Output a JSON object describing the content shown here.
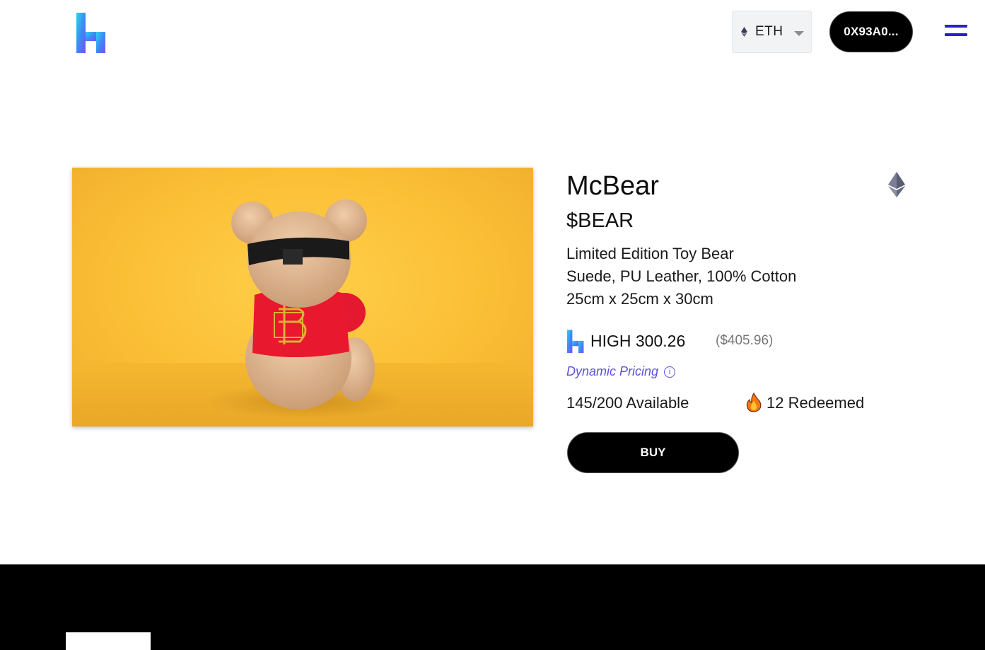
{
  "header": {
    "network": {
      "label": "ETH",
      "icon": "ethereum-icon"
    },
    "wallet_label": "0X93A0...",
    "menu_icon": "hamburger-menu-icon",
    "accent_color": "#2b1fd6"
  },
  "product": {
    "image_alt": "teddy-bear-back-view",
    "name": "McBear",
    "ticker": "$BEAR",
    "description": [
      "Limited Edition Toy Bear",
      "Suede, PU Leather, 100% Cotton",
      "25cm x 25cm x 30cm"
    ],
    "price": "HIGH 300.26",
    "price_usd": "($405.96)",
    "pricing_label": "Dynamic Pricing",
    "available": "145/200 Available",
    "redeemed": "12 Redeemed",
    "buy_label": "BUY"
  },
  "colors": {
    "pricing_link": "#5b4fd8",
    "image_background": "#fbbf36",
    "footer": "#000000"
  }
}
